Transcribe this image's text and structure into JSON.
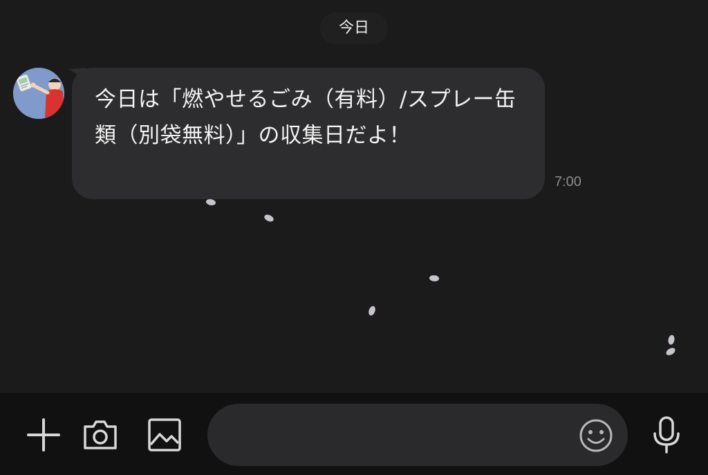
{
  "chat": {
    "date_label": "今日",
    "messages": [
      {
        "text": "今日は「燃やせるごみ（有料）/スプレー缶類（別袋無料）」の収集日だよ！",
        "time": "7:00"
      }
    ]
  },
  "composer": {
    "input_value": "",
    "input_placeholder": "",
    "icons": [
      "plus-icon",
      "camera-icon",
      "image-icon",
      "emoji-icon",
      "microphone-icon"
    ]
  },
  "colors": {
    "background": "#1b1b1c",
    "bubble": "#2d2d2f",
    "composer_bar": "#111112",
    "input_field": "#2a2a2c",
    "icon": "#d8d8d8",
    "timestamp": "#8c8c8e"
  }
}
